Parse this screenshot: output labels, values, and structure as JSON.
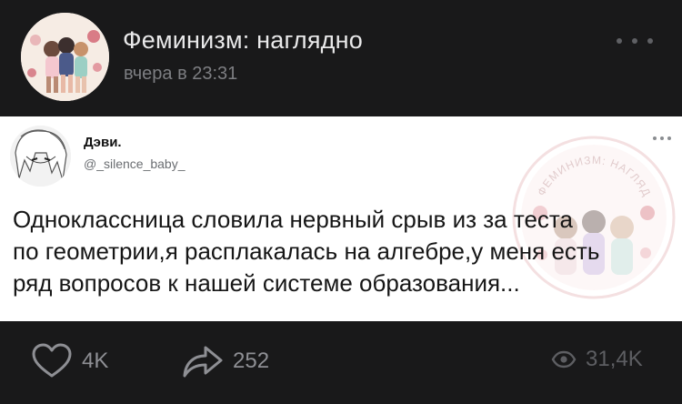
{
  "post": {
    "community_name": "Феминизм: наглядно",
    "timestamp": "вчера в 23:31"
  },
  "tweet": {
    "author_name": "Дэви.",
    "author_handle": "@_silence_baby_",
    "text_lines": [
      "Одноклассница словила нервный срыв из за теста",
      "по геометрии,я расплакалась на алгебре,у меня есть",
      "ряд вопросов к нашей системе образования..."
    ],
    "watermark_text": "ФЕМИНИЗМ: НАГЛЯДНО"
  },
  "actions": {
    "likes": "4K",
    "shares": "252",
    "views": "31,4K"
  },
  "icons": {
    "like": "heart-icon",
    "share": "share-arrow-icon",
    "views": "eye-icon",
    "more": "more-dots-icon"
  },
  "colors": {
    "background": "#19191a",
    "card": "#ffffff",
    "title_text": "#e9e9ea",
    "muted_text": "#7d7e82"
  }
}
